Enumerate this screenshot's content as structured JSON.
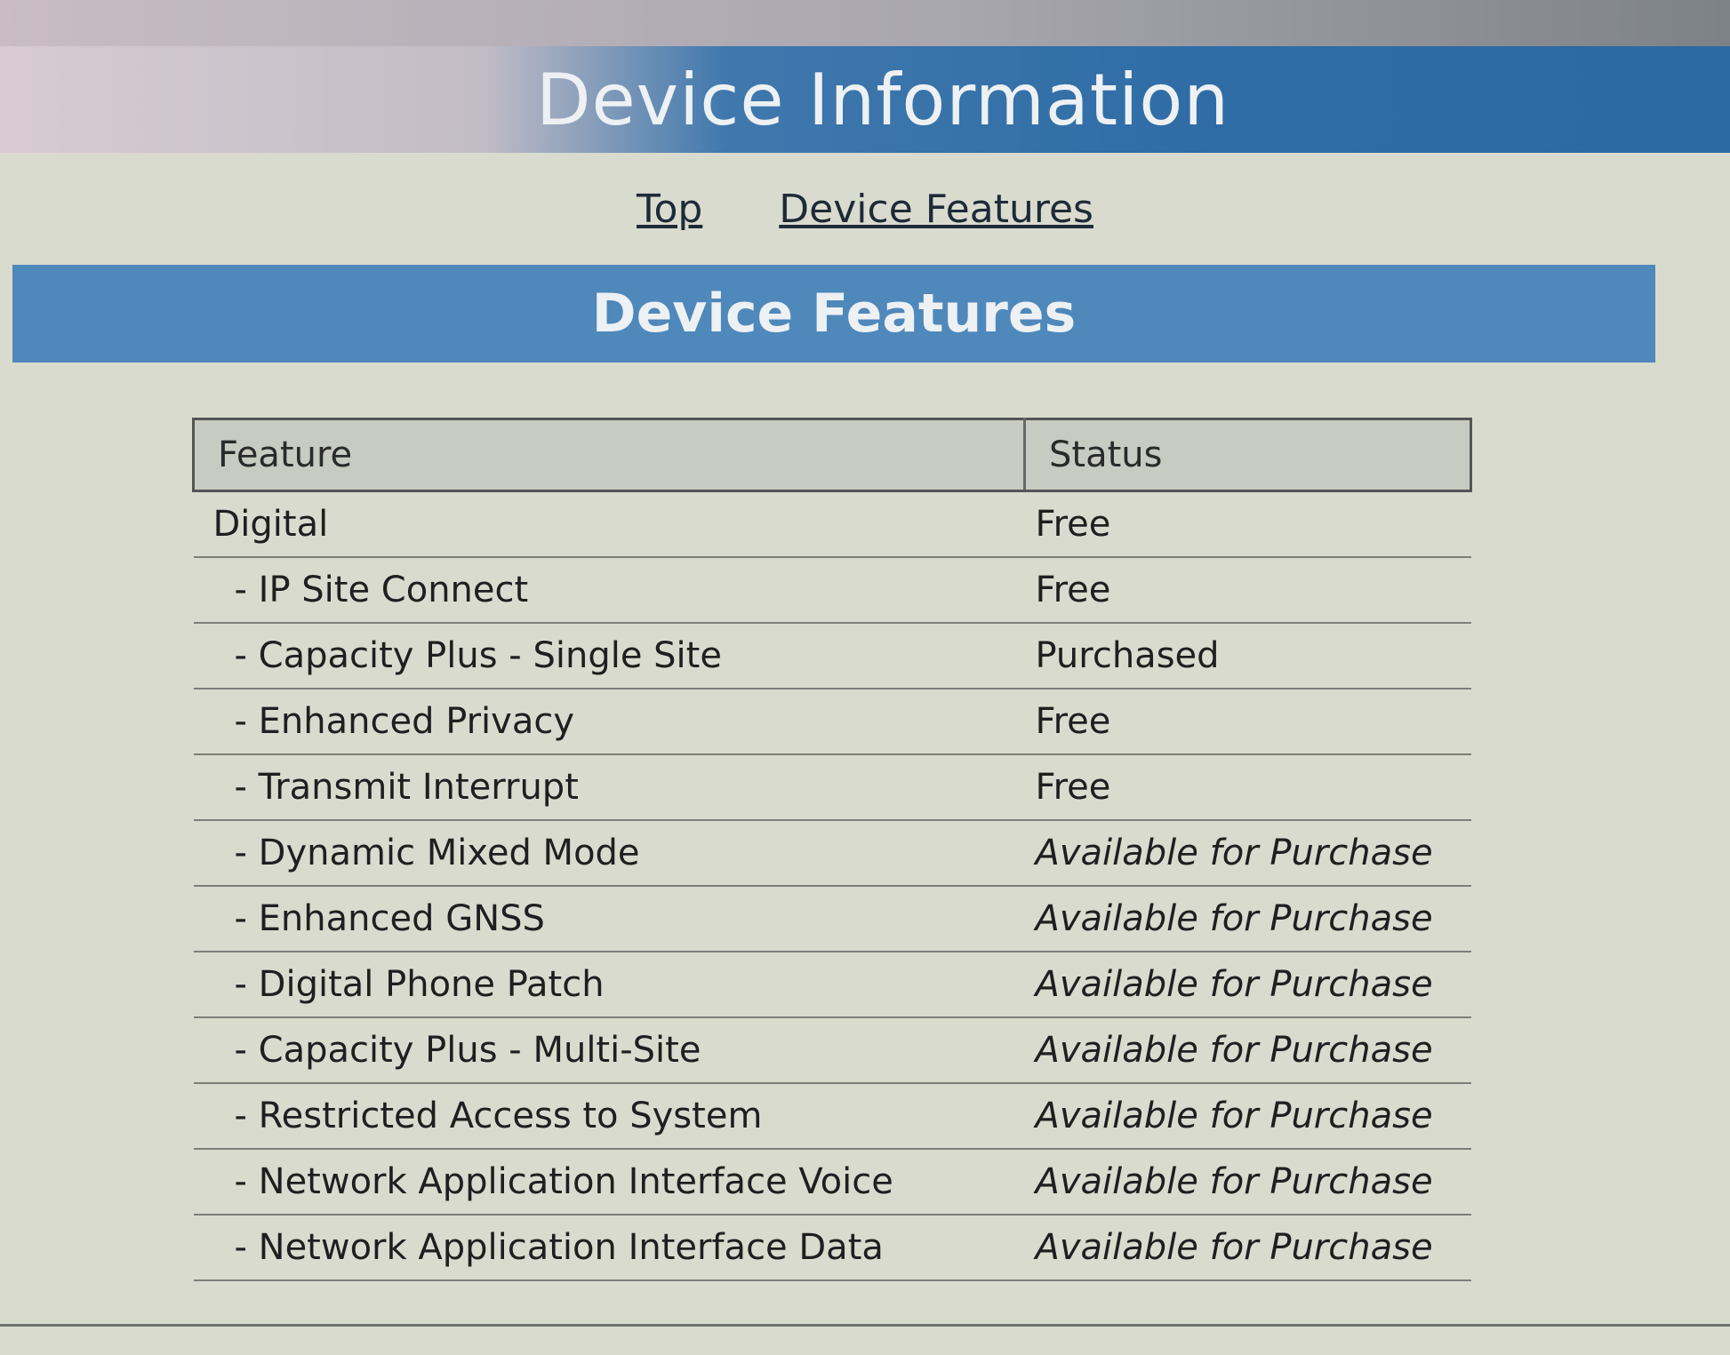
{
  "header": {
    "title": "Device Information"
  },
  "nav": {
    "links": [
      "Top",
      "Device Features"
    ]
  },
  "section": {
    "title": "Device Features"
  },
  "table": {
    "columns": [
      "Feature",
      "Status"
    ],
    "rows": [
      {
        "feature": "Digital",
        "status": "Free"
      },
      {
        "feature": "- IP Site Connect",
        "status": "Free"
      },
      {
        "feature": "- Capacity Plus - Single Site",
        "status": "Purchased"
      },
      {
        "feature": "- Enhanced Privacy",
        "status": "Free"
      },
      {
        "feature": "- Transmit Interrupt",
        "status": "Free"
      },
      {
        "feature": "- Dynamic Mixed Mode",
        "status": "Available for Purchase"
      },
      {
        "feature": "- Enhanced GNSS",
        "status": "Available for Purchase"
      },
      {
        "feature": "- Digital Phone Patch",
        "status": "Available for Purchase"
      },
      {
        "feature": "- Capacity Plus - Multi-Site",
        "status": "Available for Purchase"
      },
      {
        "feature": "- Restricted Access to System",
        "status": "Available for Purchase"
      },
      {
        "feature": "- Network Application Interface Voice",
        "status": "Available for Purchase"
      },
      {
        "feature": "- Network Application Interface Data",
        "status": "Available for Purchase"
      }
    ]
  },
  "colors": {
    "title_banner": "#2f6ca6",
    "section_banner": "#4f88bb",
    "background": "#d9dbce",
    "header_row": "#c8cbc1"
  }
}
